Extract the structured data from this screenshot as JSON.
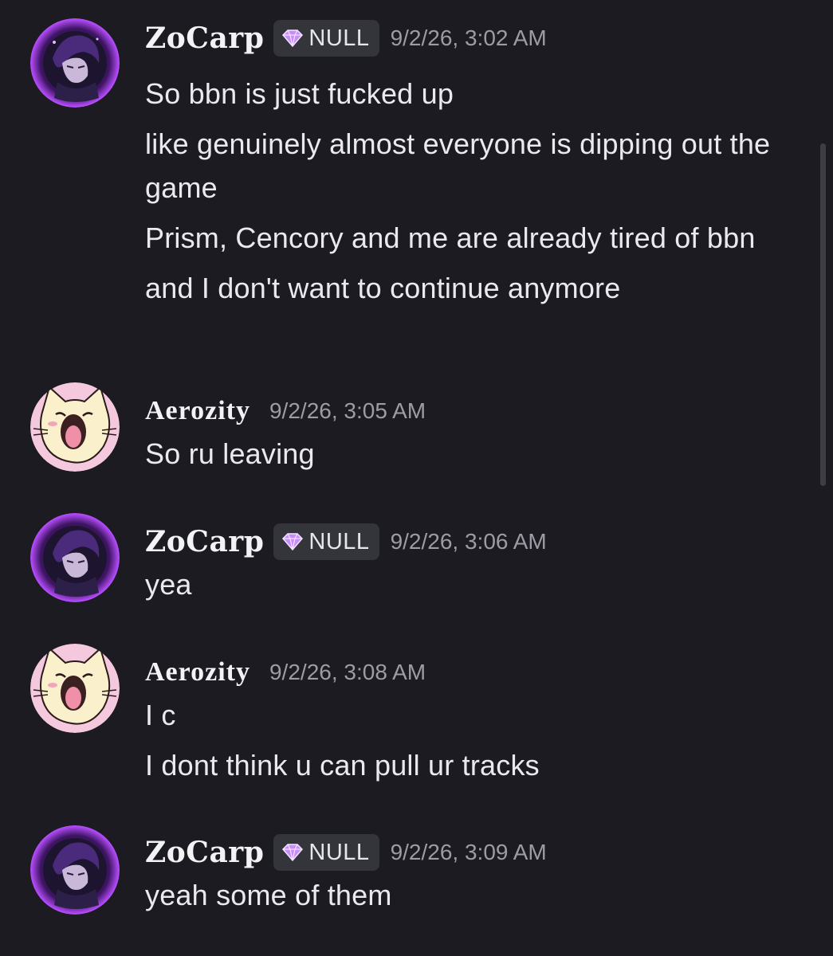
{
  "colors": {
    "background": "#1c1b22",
    "badge_bg": "#34343b",
    "timestamp": "#9c9ca5",
    "avatar_zocarp_glow": "#b84dff",
    "avatar_aerozity_bg": "#f4c9de"
  },
  "messages": [
    {
      "user": "ZoCarp",
      "avatar": "zocarp-avatar",
      "badge_icon": "gem-icon",
      "badge": "NULL",
      "timestamp": "9/2/26, 3:02 AM",
      "lines": [
        "So bbn is just fucked up",
        "like genuinely almost everyone is dipping out the game",
        "Prism, Cencory and me are already tired of bbn",
        "and I don't want to continue anymore"
      ]
    },
    {
      "user": "Aerozity",
      "avatar": "aerozity-cat-avatar",
      "timestamp": "9/2/26, 3:05 AM",
      "lines": [
        "So ru leaving"
      ]
    },
    {
      "user": "ZoCarp",
      "avatar": "zocarp-avatar",
      "badge_icon": "gem-icon",
      "badge": "NULL",
      "timestamp": "9/2/26, 3:06 AM",
      "lines": [
        "yea"
      ]
    },
    {
      "user": "Aerozity",
      "avatar": "aerozity-cat-avatar",
      "timestamp": "9/2/26, 3:08 AM",
      "lines": [
        "I c",
        "I dont think u can pull ur tracks"
      ]
    },
    {
      "user": "ZoCarp",
      "avatar": "zocarp-avatar",
      "badge_icon": "gem-icon",
      "badge": "NULL",
      "timestamp": "9/2/26, 3:09 AM",
      "lines": [
        "yeah some of them"
      ]
    }
  ]
}
